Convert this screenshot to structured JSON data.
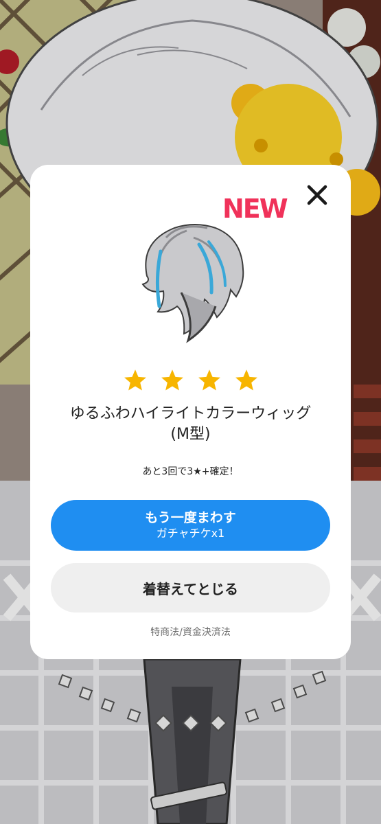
{
  "colors": {
    "accent_blue": "#1f8ef1",
    "new_red": "#f0325a",
    "star_yellow": "#f7b500",
    "hair_highlight": "#3aa8d8"
  },
  "icons": {
    "close": "close-icon",
    "star": "star-icon"
  },
  "dialog": {
    "new_badge": "NEW",
    "rarity_stars": 4,
    "item_name_line1": "ゆるふわハイライトカラーウィッグ",
    "item_name_line2": "(M型)",
    "guarantee_text": "あと3回で3★+確定！",
    "spin_again_label": "もう一度まわす",
    "spin_again_cost": "ガチャチケx1",
    "close_button_label": "着替えてとじる",
    "legal_link": "特商法/資金決済法"
  }
}
